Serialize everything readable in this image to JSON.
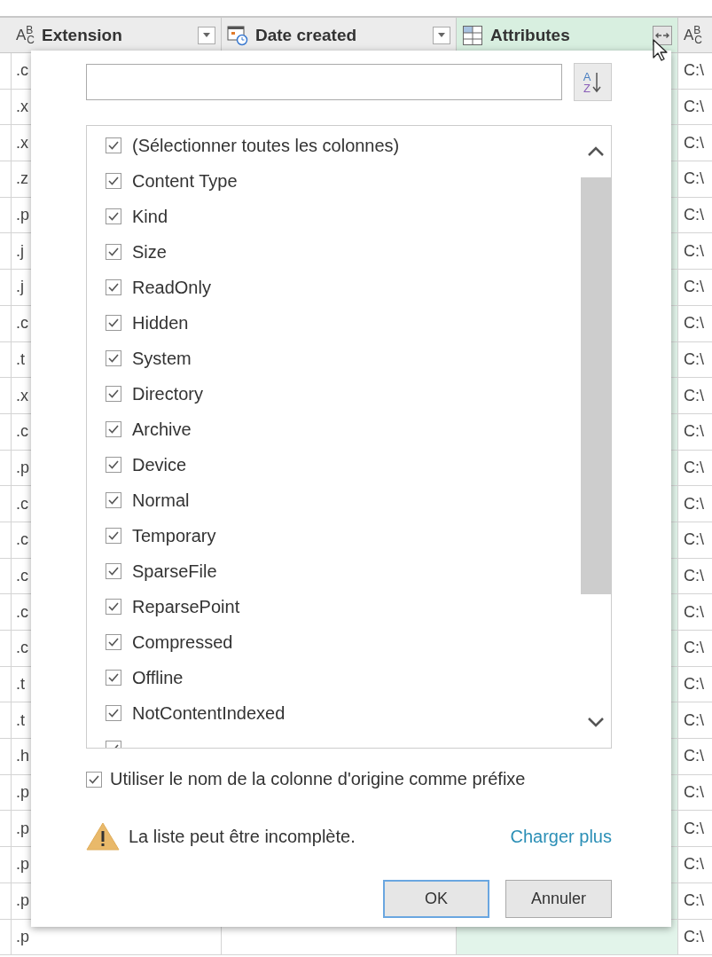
{
  "columns": [
    {
      "kind": "text",
      "type_glyph": "A$^{B}$$_{C}$",
      "label": "Extension",
      "selected": false
    },
    {
      "kind": "date",
      "label": "Date created",
      "selected": false
    },
    {
      "kind": "table",
      "label": "Attributes",
      "selected": true
    },
    {
      "kind": "text",
      "type_glyph": "A$^{B}$$_{C}$",
      "selected": false
    }
  ],
  "rows": [
    {
      "extension": ".c",
      "column_4": "C:\\"
    },
    {
      "extension": ".x",
      "column_4": "C:\\"
    },
    {
      "extension": ".x",
      "column_4": "C:\\"
    },
    {
      "extension": ".z",
      "column_4": "C:\\"
    },
    {
      "extension": ".p",
      "column_4": "C:\\"
    },
    {
      "extension": ".j",
      "column_4": "C:\\"
    },
    {
      "extension": ".j",
      "column_4": "C:\\"
    },
    {
      "extension": ".c",
      "column_4": "C:\\"
    },
    {
      "extension": ".t",
      "column_4": "C:\\"
    },
    {
      "extension": ".x",
      "column_4": "C:\\"
    },
    {
      "extension": ".c",
      "column_4": "C:\\"
    },
    {
      "extension": ".p",
      "column_4": "C:\\"
    },
    {
      "extension": ".c",
      "column_4": "C:\\"
    },
    {
      "extension": ".c",
      "column_4": "C:\\"
    },
    {
      "extension": ".c",
      "column_4": "C:\\"
    },
    {
      "extension": ".c",
      "column_4": "C:\\"
    },
    {
      "extension": ".c",
      "column_4": "C:\\"
    },
    {
      "extension": ".t",
      "column_4": "C:\\"
    },
    {
      "extension": ".t",
      "column_4": "C:\\"
    },
    {
      "extension": ".h",
      "column_4": "C:\\"
    },
    {
      "extension": ".p",
      "column_4": "C:\\"
    },
    {
      "extension": ".p",
      "column_4": "C:\\"
    },
    {
      "extension": ".p",
      "column_4": "C:\\"
    },
    {
      "extension": ".p",
      "column_4": "C:\\"
    },
    {
      "extension": ".p",
      "column_4": "C:\\"
    }
  ],
  "expand_popup": {
    "sort_button": {
      "top": "A",
      "bottom": "Z"
    },
    "items": [
      {
        "label": "(Sélectionner toutes les colonnes)",
        "checked": true
      },
      {
        "label": "Content Type",
        "checked": true
      },
      {
        "label": "Kind",
        "checked": true
      },
      {
        "label": "Size",
        "checked": true
      },
      {
        "label": "ReadOnly",
        "checked": true
      },
      {
        "label": "Hidden",
        "checked": true
      },
      {
        "label": "System",
        "checked": true
      },
      {
        "label": "Directory",
        "checked": true
      },
      {
        "label": "Archive",
        "checked": true
      },
      {
        "label": "Device",
        "checked": true
      },
      {
        "label": "Normal",
        "checked": true
      },
      {
        "label": "Temporary",
        "checked": true
      },
      {
        "label": "SparseFile",
        "checked": true
      },
      {
        "label": "ReparsePoint",
        "checked": true
      },
      {
        "label": "Compressed",
        "checked": true
      },
      {
        "label": "Offline",
        "checked": true
      },
      {
        "label": "NotContentIndexed",
        "checked": true
      },
      {
        "checked": true
      }
    ],
    "prefix_option": {
      "label": "Utiliser le nom de la colonne d'origine comme préfixe",
      "checked": true
    },
    "warning": "La liste peut être incomplète.",
    "load_more_link": "Charger plus",
    "buttons": [
      {
        "label": "OK",
        "default": true
      },
      {
        "label": "Annuler",
        "default": false
      }
    ]
  }
}
